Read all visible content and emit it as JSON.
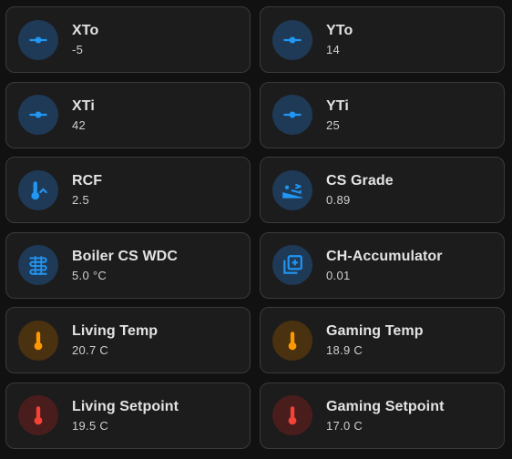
{
  "tiles": [
    {
      "name": "XTo",
      "state": "-5",
      "icon": "slider-icon",
      "color": "#1f3a57",
      "accent": "#2196f3"
    },
    {
      "name": "YTo",
      "state": "14",
      "icon": "slider-icon",
      "color": "#1f3a57",
      "accent": "#2196f3"
    },
    {
      "name": "XTi",
      "state": "42",
      "icon": "slider-icon",
      "color": "#1f3a57",
      "accent": "#2196f3"
    },
    {
      "name": "YTi",
      "state": "25",
      "icon": "slider-icon",
      "color": "#1f3a57",
      "accent": "#2196f3"
    },
    {
      "name": "RCF",
      "state": "2.5",
      "icon": "thermometer-chevron-up-icon",
      "color": "#1f3a57",
      "accent": "#2196f3"
    },
    {
      "name": "CS Grade",
      "state": "0.89",
      "icon": "slope-uphill-icon",
      "color": "#1f3a57",
      "accent": "#2196f3"
    },
    {
      "name": "Boiler CS WDC",
      "state": "5.0 °C",
      "icon": "heating-coil-icon",
      "color": "#1f3a57",
      "accent": "#2196f3"
    },
    {
      "name": "CH-Accumulator",
      "state": "0.01",
      "icon": "plus-box-multiple-icon",
      "color": "#1f3a57",
      "accent": "#2196f3"
    },
    {
      "name": "Living Temp",
      "state": "20.7 C",
      "icon": "thermometer-icon",
      "color": "#4a3110",
      "accent": "#ff9800"
    },
    {
      "name": "Gaming Temp",
      "state": "18.9 C",
      "icon": "thermometer-icon",
      "color": "#4a3110",
      "accent": "#ff9800"
    },
    {
      "name": "Living Setpoint",
      "state": "19.5 C",
      "icon": "thermometer-icon",
      "color": "#4a1d1d",
      "accent": "#f44336"
    },
    {
      "name": "Gaming Setpoint",
      "state": "17.0 C",
      "icon": "thermometer-icon",
      "color": "#4a1d1d",
      "accent": "#f44336"
    }
  ]
}
